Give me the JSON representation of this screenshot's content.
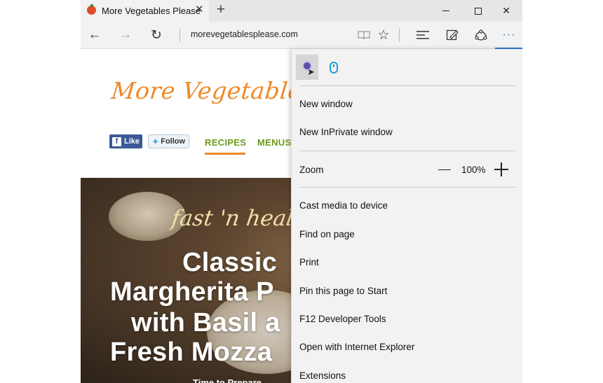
{
  "tab": {
    "title": "More Vegetables Please",
    "close_glyph": "✕",
    "new_tab_glyph": "+"
  },
  "window": {
    "minimize": "minimize",
    "maximize": "maximize",
    "close_glyph": "✕"
  },
  "navbar": {
    "address": "morevegetablesplease.com",
    "back_glyph": "←",
    "forward_glyph": "→",
    "refresh_glyph": "↻",
    "reading_view_glyph": "📖",
    "favorite_glyph": "☆",
    "hub_glyph": "≡",
    "note_glyph": "✎",
    "share_glyph": "⟳",
    "more_glyph": "···"
  },
  "page": {
    "logo": "More Vegetables P",
    "fb_like": "Like",
    "tw_follow": "Follow",
    "nav": [
      "RECIPES",
      "MENUS"
    ],
    "hero_tag": "fast 'n healthy",
    "hero_title": [
      "Classic",
      "Margherita P",
      "with Basil a",
      "Fresh Mozza"
    ],
    "hero_sub": "Time to Prepare"
  },
  "menu": {
    "items": [
      "New window",
      "New InPrivate window",
      "Zoom",
      "Cast media to device",
      "Find on page",
      "Print",
      "Pin this page to Start",
      "F12 Developer Tools",
      "Open with Internet Explorer",
      "Extensions"
    ],
    "zoom_value": "100%"
  },
  "colors": {
    "accent": "#2f78d0",
    "logo": "#ee8a28",
    "nav_green": "#6d9a1e",
    "facebook": "#3b5998"
  }
}
